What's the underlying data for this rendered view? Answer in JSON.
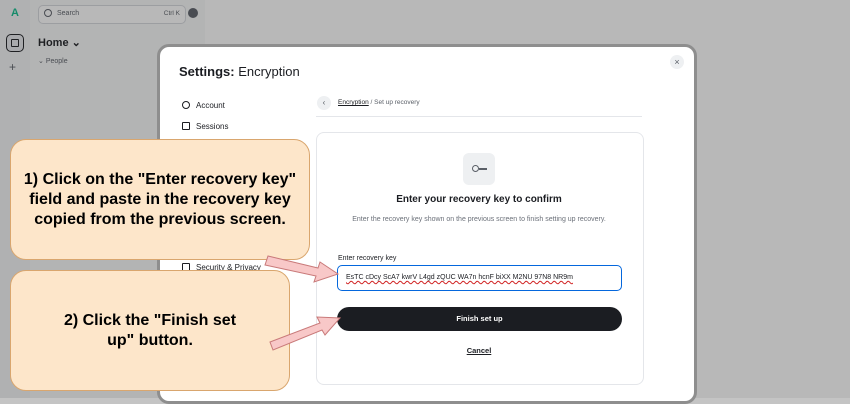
{
  "rail": {
    "logo_letter": "A",
    "add_symbol": "+"
  },
  "left_panel": {
    "search_placeholder": "Search",
    "search_shortcut": "Ctrl K",
    "home_title": "Home",
    "people_label": "People"
  },
  "dialog": {
    "title_prefix": "Settings:",
    "title_section": "Encryption",
    "close_symbol": "×",
    "nav": [
      {
        "label": "Account"
      },
      {
        "label": "Sessions"
      },
      {
        "label": "Security & Privacy"
      }
    ],
    "breadcrumb": {
      "back_symbol": "‹",
      "link": "Encryption",
      "separator": "/",
      "current": "Set up recovery"
    },
    "heading": "Enter your recovery key to confirm",
    "subtext": "Enter the recovery key shown on the previous screen to finish setting up recovery.",
    "field_label": "Enter recovery key",
    "field_value": "EsTC cDcy ScA7 kwrV L4gd zQUC WA7n hcnF biXX M2NU 97N8 NR9m",
    "finish_button": "Finish set up",
    "cancel_link": "Cancel"
  },
  "callouts": {
    "step1": "1) Click on the \"Enter recovery key\" field and paste in the recovery key copied from the previous screen.",
    "step2": "2) Click the \"Finish set up\" button."
  },
  "colors": {
    "accent_focus": "#0467dd",
    "callout_fill": "#fde6ca",
    "arrow_fill": "#f8c8c8",
    "button_dark": "#1b1d22"
  }
}
